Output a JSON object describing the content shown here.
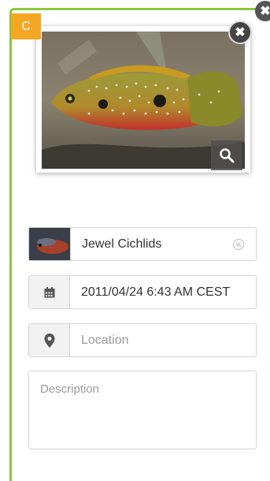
{
  "card": {
    "badge_label": "C",
    "accent_color": "#8cc63f",
    "badge_color": "#f5a623"
  },
  "buttons": {
    "close_icon": "close-icon",
    "zoom_icon": "magnifier-icon"
  },
  "fields": {
    "species_value": "Jewel Cichlids",
    "species_clear_icon": "clear-circle-icon",
    "date_icon": "calendar-icon",
    "date_value": "2011/04/24 6:43 AM CEST",
    "location_icon": "map-marker-icon",
    "location_placeholder": "Location",
    "description_placeholder": "Description"
  }
}
